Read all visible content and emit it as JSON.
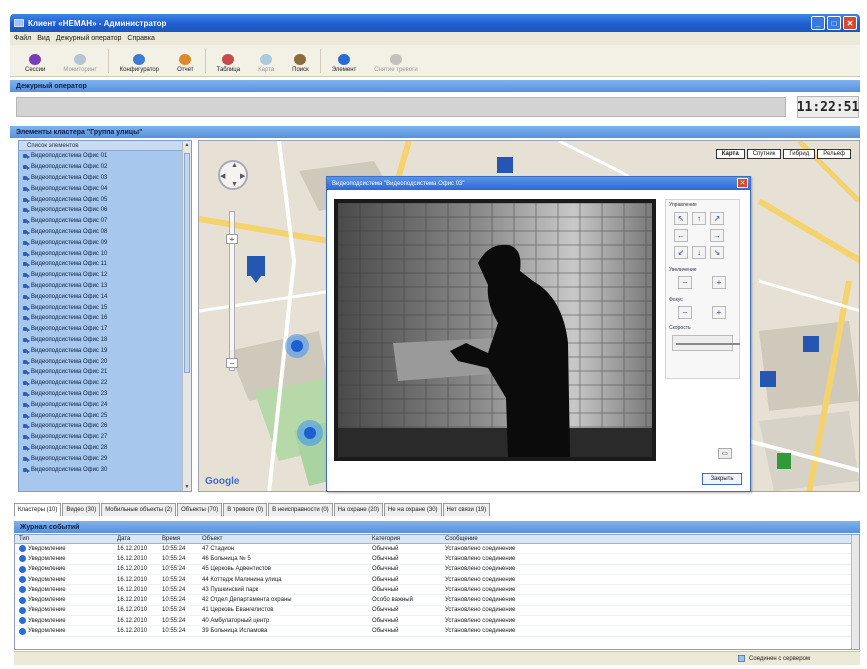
{
  "window": {
    "title": "Клиент «НЕМАН» - Администратор"
  },
  "menu": [
    "Файл",
    "Вид",
    "Дежурный оператор",
    "Справка"
  ],
  "toolbar": [
    {
      "label": "Сессии",
      "icon": "sessions-icon",
      "color": "#7a3db8",
      "enabled": true
    },
    {
      "label": "Мониторинг",
      "icon": "monitoring-icon",
      "color": "#6a8fbf",
      "enabled": false
    },
    {
      "label": "Конфигуратор",
      "icon": "configurator-icon",
      "color": "#3c7bd4",
      "enabled": true
    },
    {
      "label": "Отчет",
      "icon": "report-icon",
      "color": "#e0892b",
      "enabled": true
    },
    {
      "label": "Таблица",
      "icon": "table-icon",
      "color": "#c74a4a",
      "enabled": true
    },
    {
      "label": "Карта",
      "icon": "map-icon",
      "color": "#5a9bd8",
      "enabled": false
    },
    {
      "label": "Поиск",
      "icon": "search-icon",
      "color": "#8c6a3a",
      "enabled": true
    },
    {
      "label": "Элемент",
      "icon": "info-icon",
      "color": "#2a6cd6",
      "enabled": true
    },
    {
      "label": "Снятие тревоги",
      "icon": "alarm-off-icon",
      "color": "#888888",
      "enabled": false
    }
  ],
  "operator_section": {
    "title": "Дежурный оператор",
    "time": "11:22:51"
  },
  "cluster_section": {
    "title": "Элементы кластера \"Группа улицы\""
  },
  "tree": {
    "header": "Список элементов",
    "items": [
      "Видеоподсистема Офис 01",
      "Видеоподсистема Офис 02",
      "Видеоподсистема Офис 03",
      "Видеоподсистема Офис 04",
      "Видеоподсистема Офис 05",
      "Видеоподсистема Офис 06",
      "Видеоподсистема Офис 07",
      "Видеоподсистема Офис 08",
      "Видеоподсистема Офис 09",
      "Видеоподсистема Офис 10",
      "Видеоподсистема Офис 11",
      "Видеоподсистема Офис 12",
      "Видеоподсистема Офис 13",
      "Видеоподсистема Офис 14",
      "Видеоподсистема Офис 15",
      "Видеоподсистема Офис 16",
      "Видеоподсистема Офис 17",
      "Видеоподсистема Офис 18",
      "Видеоподсистема Офис 19",
      "Видеоподсистема Офис 20",
      "Видеоподсистема Офис 21",
      "Видеоподсистема Офис 22",
      "Видеоподсистема Офис 23",
      "Видеоподсистема Офис 24",
      "Видеоподсистема Офис 25",
      "Видеоподсистема Офис 26",
      "Видеоподсистема Офис 27",
      "Видеоподсистема Офис 28",
      "Видеоподсистема Офис 29",
      "Видеоподсистема Офис 30"
    ]
  },
  "map": {
    "types": [
      "Карта",
      "Спутник",
      "Гибрид",
      "Рельеф"
    ],
    "active_type": "Карта",
    "logo": "Google"
  },
  "video_window": {
    "title": "Видеоподсистема \"Видеоподсистема Офис 03\"",
    "ptz_title": "Управление",
    "zoom_title": "Увеличение",
    "focus_title": "Фокус",
    "speed_title": "Скорость",
    "close_label": "Закрыть"
  },
  "tabs": [
    "Кластеры (10)",
    "Видео (30)",
    "Мобильные объекты (2)",
    "Объекты (70)",
    "В тревоге (0)",
    "В неисправности (0)",
    "На охране (20)",
    "Не на охране (30)",
    "Нет связи (19)"
  ],
  "journal": {
    "title": "Журнал событий",
    "columns": [
      "Тип",
      "Дата",
      "Время",
      "Объект",
      "Категория",
      "Сообщение"
    ],
    "rows": [
      [
        "Уведомление",
        "16.12.2010",
        "10:55:24",
        "47 Стадион",
        "Обычный",
        "Установлено соединение"
      ],
      [
        "Уведомление",
        "16.12.2010",
        "10:55:24",
        "46 Больница № 5",
        "Обычный",
        "Установлено соединение"
      ],
      [
        "Уведомление",
        "16.12.2010",
        "10:55:24",
        "45 Церковь Адвентистов",
        "Обычный",
        "Установлено соединение"
      ],
      [
        "Уведомление",
        "16.12.2010",
        "10:55:24",
        "44 Коттедж Малинина улица",
        "Обычный",
        "Установлено соединение"
      ],
      [
        "Уведомление",
        "16.12.2010",
        "10:55:24",
        "43 Пушкинский парк",
        "Обычный",
        "Установлено соединение"
      ],
      [
        "Уведомление",
        "16.12.2010",
        "10:55:24",
        "42 Отдел Департамента охраны",
        "Особо важный",
        "Установлено соединение"
      ],
      [
        "Уведомление",
        "16.12.2010",
        "10:55:24",
        "41 Церковь Евангелистов",
        "Обычный",
        "Установлено соединение"
      ],
      [
        "Уведомление",
        "16.12.2010",
        "10:55:24",
        "40 Амбулаторный центр",
        "Обычный",
        "Установлено соединение"
      ],
      [
        "Уведомление",
        "16.12.2010",
        "10:55:24",
        "39 Больница Исламова",
        "Обычный",
        "Установлено соединение"
      ]
    ]
  },
  "status": {
    "connection": "Соединен с сервером"
  }
}
